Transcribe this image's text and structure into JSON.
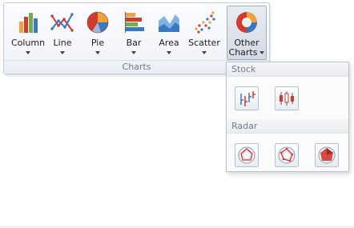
{
  "ribbon": {
    "group_label": "Charts",
    "buttons": [
      {
        "label": "Column",
        "icon": "column-chart-icon"
      },
      {
        "label": "Line",
        "icon": "line-chart-icon"
      },
      {
        "label": "Pie",
        "icon": "pie-chart-icon"
      },
      {
        "label": "Bar",
        "icon": "bar-chart-icon"
      },
      {
        "label": "Area",
        "icon": "area-chart-icon"
      },
      {
        "label": "Scatter",
        "icon": "scatter-chart-icon"
      },
      {
        "label_line1": "Other",
        "label_line2": "Charts",
        "icon": "other-charts-icon",
        "active": true
      }
    ]
  },
  "dropdown": {
    "sections": [
      {
        "title": "Stock",
        "items": [
          "stock-high-low-close-icon",
          "stock-candlestick-icon"
        ]
      },
      {
        "title": "Radar",
        "items": [
          "radar-point-icon",
          "radar-line-icon",
          "radar-area-icon"
        ]
      }
    ]
  },
  "colors": {
    "accent_blue": "#3a78c2",
    "accent_red": "#d23a2e",
    "accent_orange": "#f0a13a",
    "accent_green": "#6fb04b"
  }
}
